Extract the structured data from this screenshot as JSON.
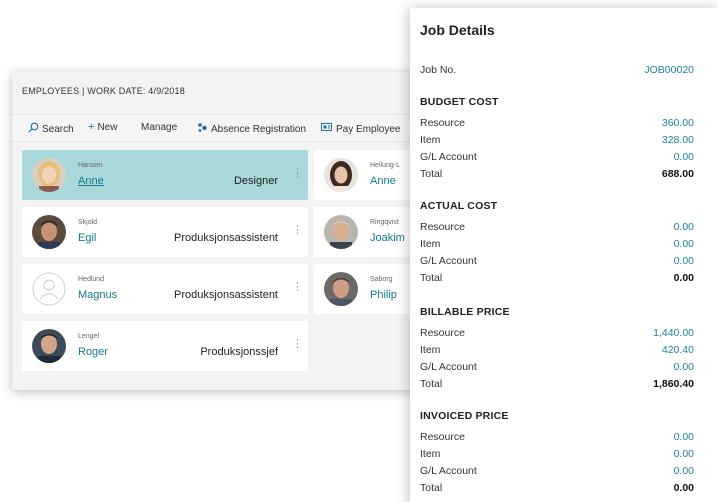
{
  "employees": {
    "title": "EMPLOYEES | WORK DATE: 4/9/2018",
    "toolbar": {
      "search": "Search",
      "new": "New",
      "manage": "Manage",
      "absence": "Absence Registration",
      "pay": "Pay Employee"
    },
    "cards": [
      {
        "last": "Hansen",
        "first": "Anne",
        "job": "Designer",
        "selected": true
      },
      {
        "last": "Skjold",
        "first": "Egil",
        "job": "Produksjonsassistent"
      },
      {
        "last": "Hedlund",
        "first": "Magnus",
        "job": "Produksjonsassistent"
      },
      {
        "last": "Lengel",
        "first": "Roger",
        "job": "Produksjonssjef"
      },
      {
        "last": "Hellung-L",
        "first": "Anne"
      },
      {
        "last": "Ringqvist",
        "first": "Joakim"
      },
      {
        "last": "Saborg",
        "first": "Philip"
      }
    ]
  },
  "job": {
    "title": "Job Details",
    "job_no_label": "Job No.",
    "job_no": "JOB00020",
    "sections": [
      {
        "title": "BUDGET COST",
        "rows": [
          {
            "label": "Resource",
            "value": "360.00"
          },
          {
            "label": "Item",
            "value": "328.00"
          },
          {
            "label": "G/L Account",
            "value": "0.00"
          }
        ],
        "total_label": "Total",
        "total": "688.00"
      },
      {
        "title": "ACTUAL COST",
        "rows": [
          {
            "label": "Resource",
            "value": "0.00"
          },
          {
            "label": "Item",
            "value": "0.00"
          },
          {
            "label": "G/L Account",
            "value": "0.00"
          }
        ],
        "total_label": "Total",
        "total": "0.00"
      },
      {
        "title": "BILLABLE PRICE",
        "rows": [
          {
            "label": "Resource",
            "value": "1,440.00"
          },
          {
            "label": "Item",
            "value": "420.40"
          },
          {
            "label": "G/L Account",
            "value": "0.00"
          }
        ],
        "total_label": "Total",
        "total": "1,860.40"
      },
      {
        "title": "INVOICED PRICE",
        "rows": [
          {
            "label": "Resource",
            "value": "0.00"
          },
          {
            "label": "Item",
            "value": "0.00"
          },
          {
            "label": "G/L Account",
            "value": "0.00"
          }
        ],
        "total_label": "Total",
        "total": "0.00"
      }
    ]
  }
}
